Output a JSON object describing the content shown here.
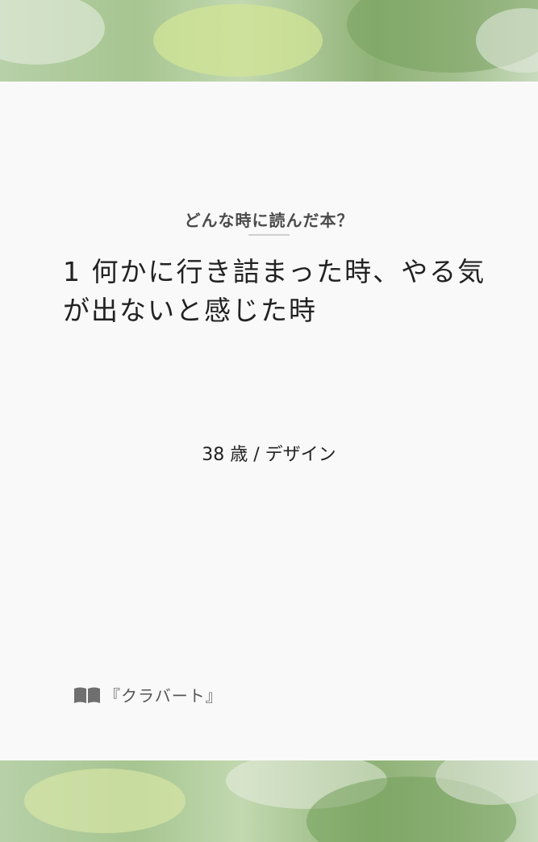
{
  "question": "どんな時に読んだ本？",
  "answer": "1 何かに行き詰まった時、やる気が出ないと感じた時",
  "meta": "38 歳 / デザイン",
  "book": {
    "icon": "open-book-icon",
    "title": "『クラバート』"
  },
  "colors": {
    "background": "#f9f9f9",
    "watercolor_green": "#a6c590",
    "text_dark": "#222222",
    "text_gray": "#4b4b4b"
  }
}
